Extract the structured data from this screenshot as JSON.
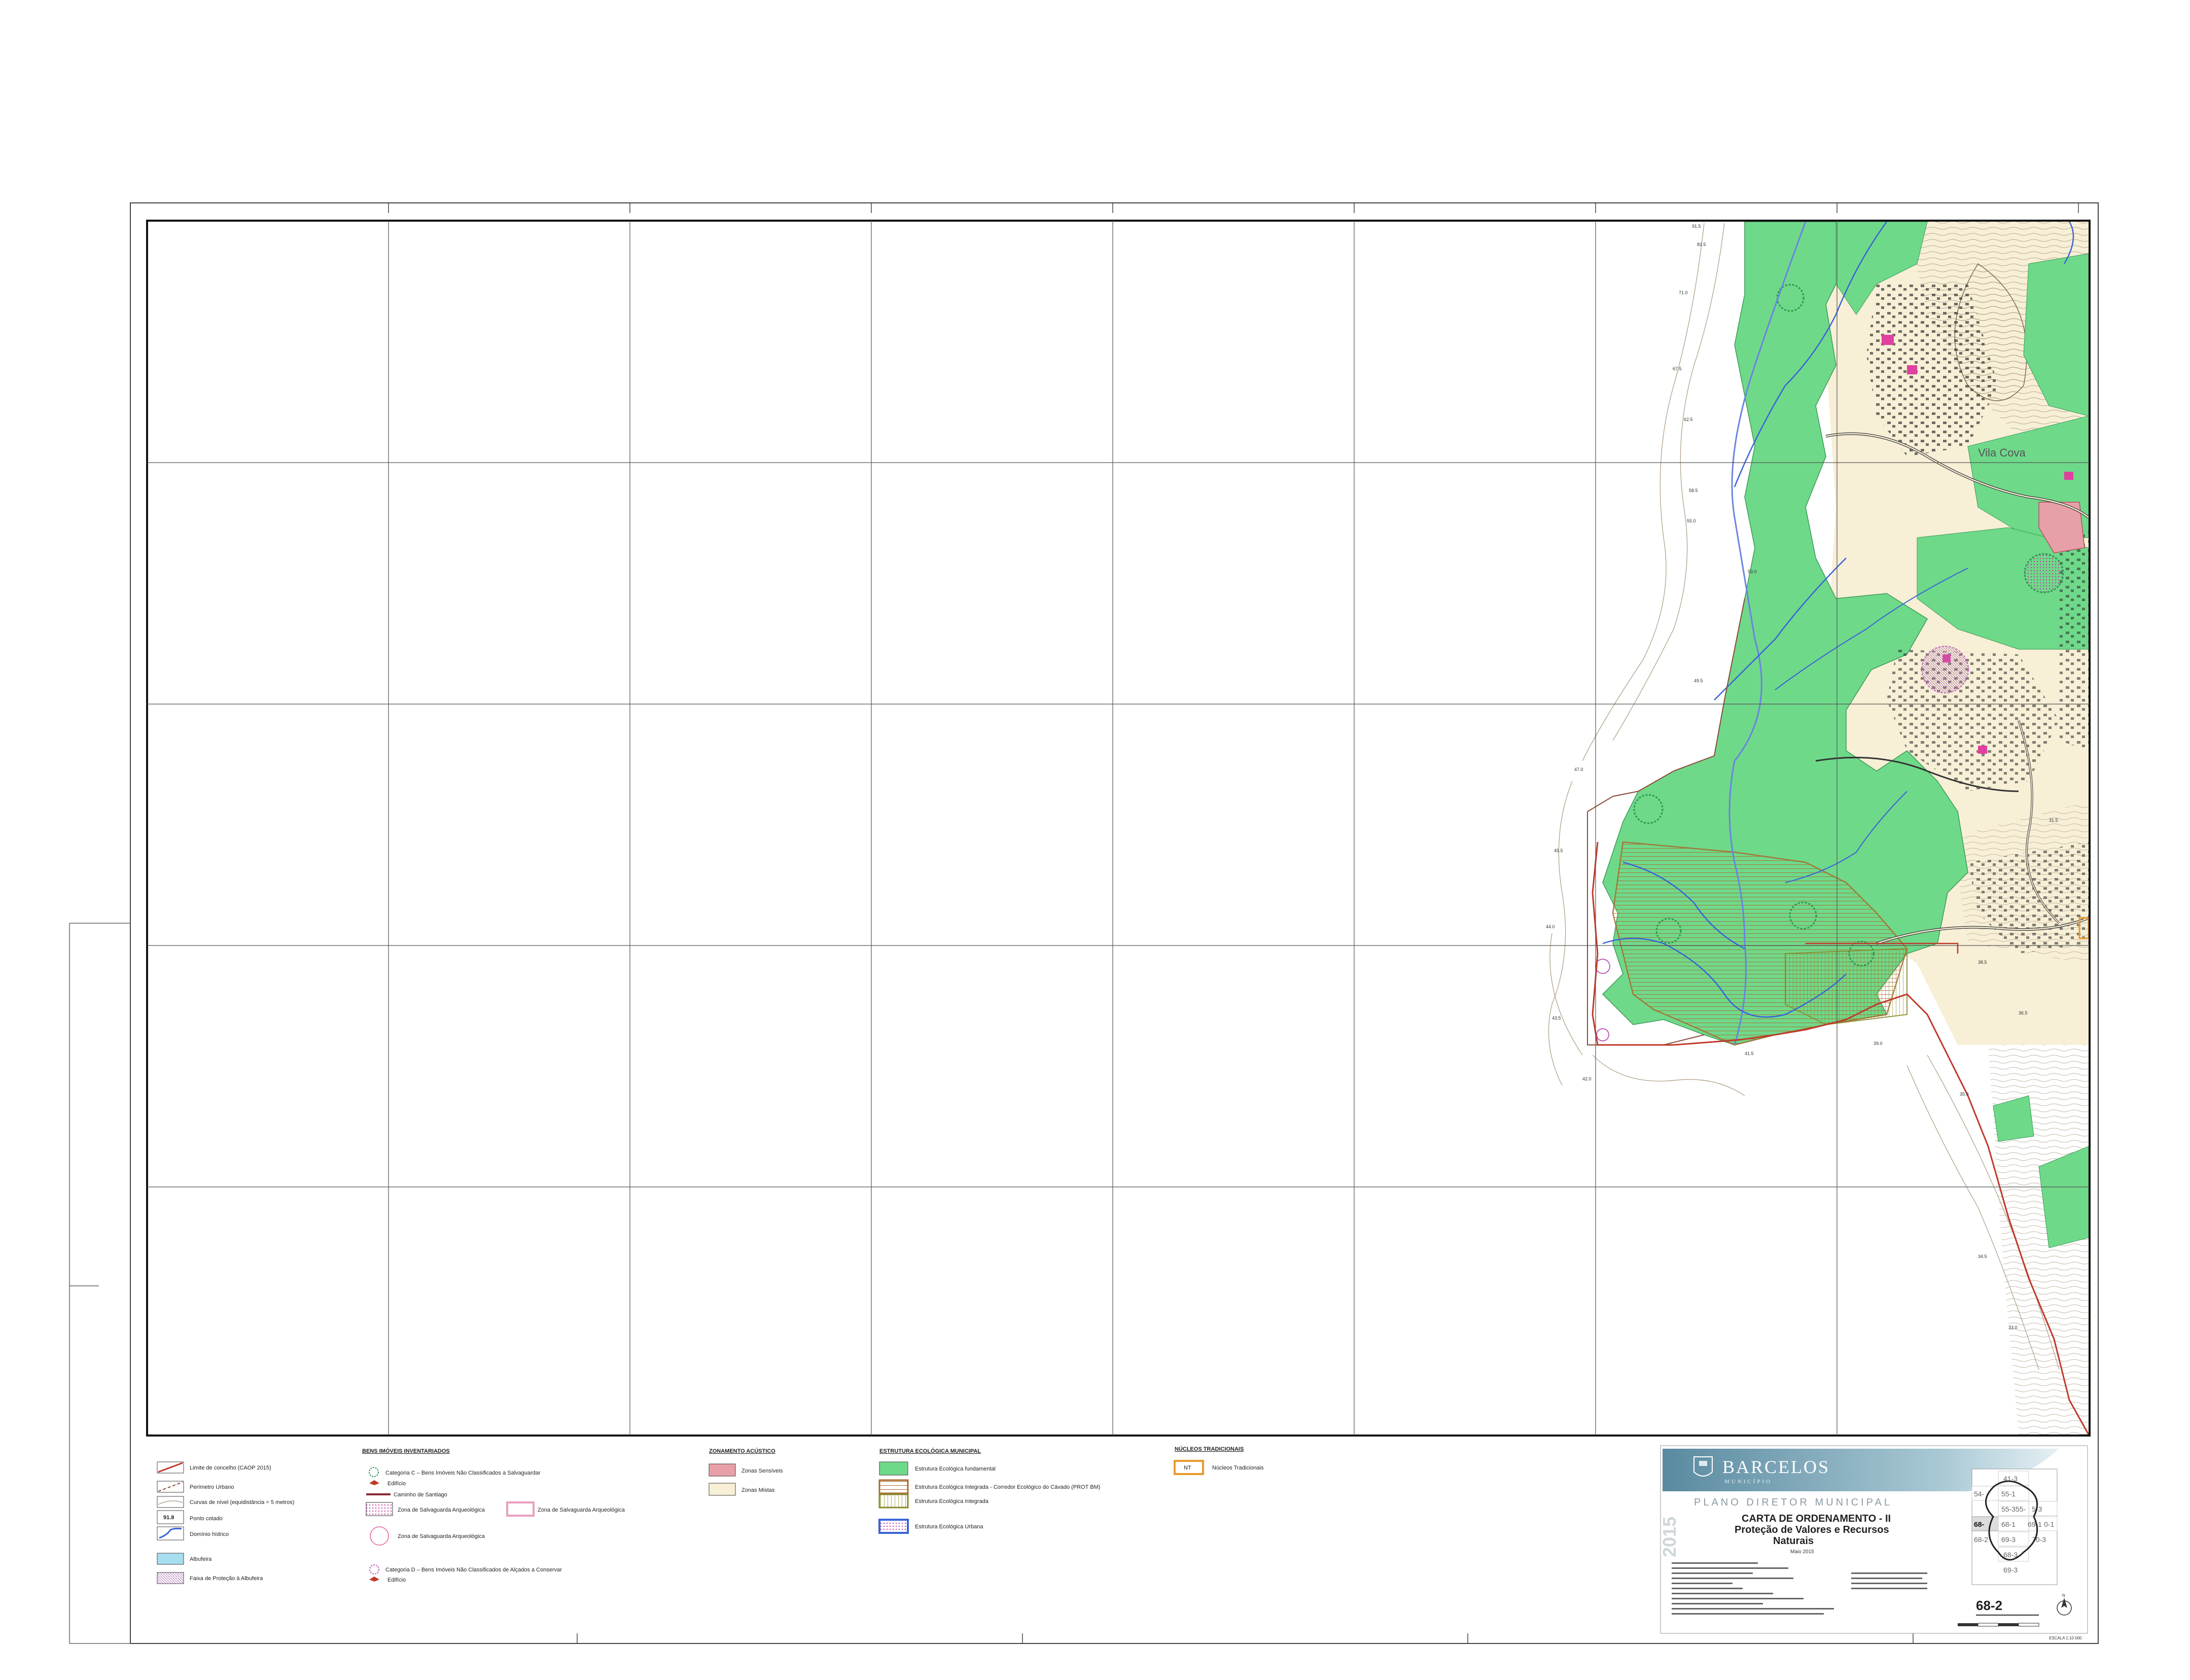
{
  "map": {
    "place_label": "Vila Cova",
    "spot_heights": [
      "91.5",
      "82.5",
      "71.0",
      "67.5",
      "62.5",
      "58.5",
      "55.0",
      "53.0",
      "49.5",
      "47.0",
      "45.5",
      "44.0",
      "43.5",
      "42.0",
      "41.5",
      "39.0",
      "38.5",
      "36.5",
      "35.0",
      "34.5",
      "33.0",
      "31.5"
    ]
  },
  "legend": {
    "col1": [
      {
        "label": "Limite de concelho (CAOP 2015)"
      },
      {
        "label": "Perímetro Urbano"
      },
      {
        "label": "Curvas de nível (equidistância = 5 metros)"
      },
      {
        "label": "Ponto cotado",
        "sample": "91.8"
      },
      {
        "label": "Domínio hídrico"
      },
      {
        "label": "Albufeira"
      },
      {
        "label": "Faixa de Proteção à Albufeira"
      }
    ],
    "col2": {
      "title": "BENS IMÓVEIS INVENTARIADOS",
      "cat_c": "Categoria C – Bens Imóveis Não Classificados a Salvaguardar",
      "edificio": "Edifício",
      "caminho": "Caminho de Santiago",
      "zona_arq_1": "Zona de Salvaguarda Arqueológica",
      "zona_arq_2": "Zona de Salvaguarda Arqueológica",
      "zona_arq_3": "Zona de Salvaguarda Arqueológica",
      "cat_d": "Categoria D – Bens Imóveis Não Classificados de Alçados a Conservar",
      "edificio_d": "Edifício"
    },
    "col3": {
      "title": "ZONAMENTO ACÚSTICO",
      "items": [
        "Zonas Sensíveis",
        "Zonas Mistas"
      ]
    },
    "col4": {
      "title": "ESTRUTURA ECOLÓGICA MUNICIPAL",
      "items": [
        "Estrutura Ecológica fundamental",
        "Estrutura Ecológica Integrada - Corredor Ecológico do Cávado (PROT BM)",
        "Estrutura Ecológica Integrada",
        "Estrutura Ecológica Urbana"
      ]
    },
    "col5": {
      "title": "NÚCLEOS TRADICIONAIS",
      "items": [
        {
          "sample": "NT",
          "label": "Núcleos Tradicionais"
        }
      ]
    }
  },
  "title_block": {
    "municipality": "BARCELOS",
    "municipality_sub": "MUNICÍPIO",
    "year": "2015",
    "plan": "PLANO DIRETOR MUNICIPAL",
    "map_title_1": "CARTA DE ORDENAMENTO - II",
    "map_title_2": "Proteção de Valores e Recursos",
    "map_title_3": "Naturais",
    "date": "Maio 2015",
    "sheet_number": "68-2",
    "scale": "ESCALA 1:10 000",
    "north": "N",
    "index_sheets": [
      "41-3",
      "54-",
      "55-1",
      "55-3",
      "55-",
      "5-3",
      "68-",
      "68-1",
      "69-1",
      "0-1",
      "68-2",
      "69-3",
      "70-3",
      "68-3",
      "69-3"
    ]
  },
  "colors": {
    "eem_green": "#6fd98a",
    "urban_beige": "#f7efd6",
    "sensitive_pink": "#e8a0a8",
    "water_blue": "#3a64d8",
    "boundary_red": "#c0392b",
    "nt_orange": "#e89a2c",
    "corridor_brown": "#a86b2c",
    "integrated_olive": "#8a8a2a"
  }
}
